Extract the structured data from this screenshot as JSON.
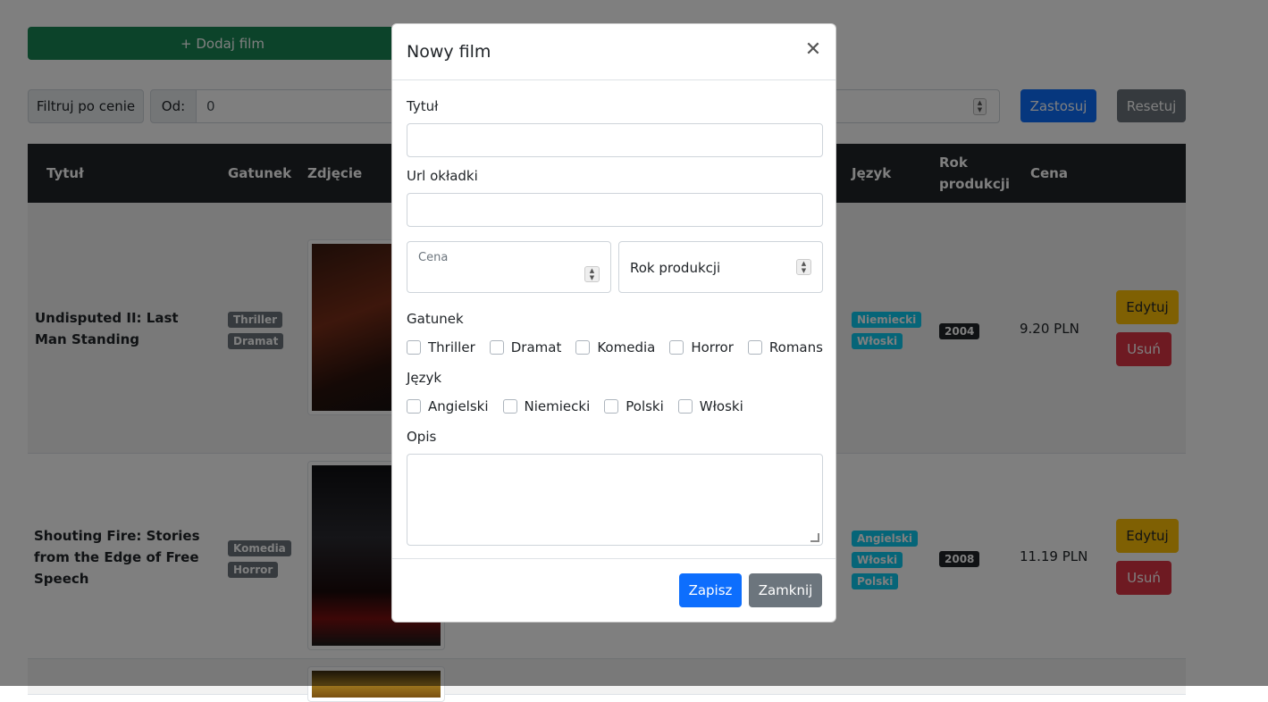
{
  "toolbar": {
    "add_label": "+ Dodaj film",
    "filter_label": "Filtruj po cenie",
    "from_label": "Od:",
    "from_value": "0",
    "apply_label": "Zastosuj",
    "reset_label": "Resetuj"
  },
  "table": {
    "headers": {
      "title": "Tytuł",
      "genre": "Gatunek",
      "photo": "Zdjęcie",
      "language": "Język",
      "year_line1": "Rok",
      "year_line2": "produkcji",
      "price": "Cena"
    },
    "rows": [
      {
        "title": "Undisputed II: Last Man Standing",
        "genres": [
          "Thriller",
          "Dramat"
        ],
        "languages": [
          "Niemiecki",
          "Włoski"
        ],
        "year": "2004",
        "price": "9.20 PLN",
        "edit": "Edytuj",
        "delete": "Usuń"
      },
      {
        "title": "Shouting Fire: Stories from the Edge of Free Speech",
        "genres": [
          "Komedia",
          "Horror"
        ],
        "languages": [
          "Angielski",
          "Włoski",
          "Polski"
        ],
        "year": "2008",
        "price": "11.19 PLN",
        "edit": "Edytuj",
        "delete": "Usuń"
      }
    ]
  },
  "modal": {
    "title": "Nowy film",
    "close_icon": "close-icon",
    "title_label": "Tytuł",
    "title_value": "",
    "url_label": "Url okładki",
    "url_value": "",
    "price_label": "Cena",
    "price_value": "",
    "year_placeholder": "Rok produkcji",
    "genre_label": "Gatunek",
    "genres": [
      "Thriller",
      "Dramat",
      "Komedia",
      "Horror",
      "Romans"
    ],
    "language_label": "Język",
    "languages": [
      "Angielski",
      "Niemiecki",
      "Polski",
      "Włoski"
    ],
    "desc_label": "Opis",
    "desc_value": "",
    "save_label": "Zapisz",
    "close_label": "Zamknij"
  },
  "colors": {
    "success": "#198754",
    "primary": "#0d6efd",
    "secondary": "#6c757d",
    "warning": "#ffc107",
    "danger": "#dc3545",
    "info": "#0dcaf0",
    "dark": "#212529"
  }
}
